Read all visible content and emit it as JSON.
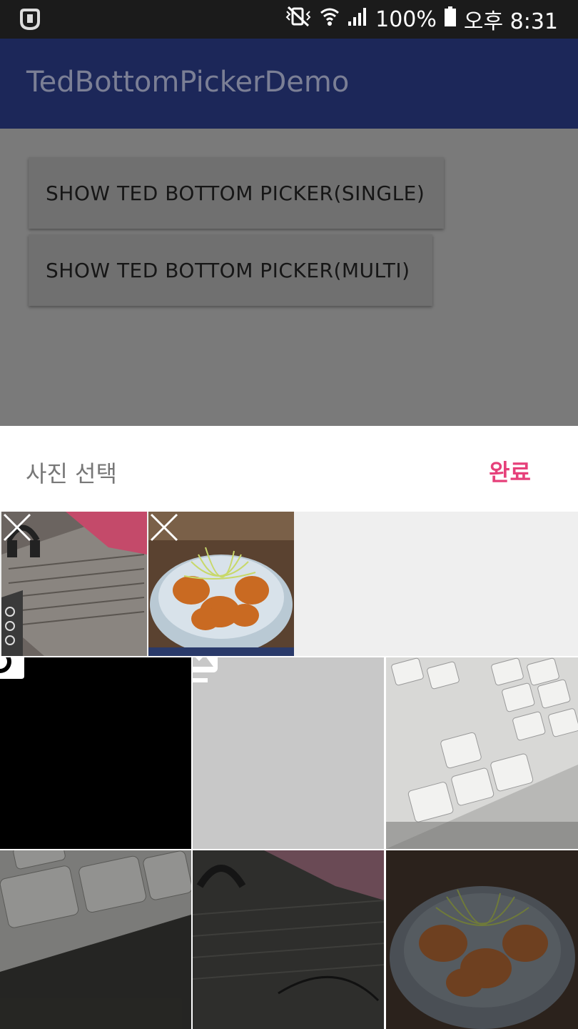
{
  "status_bar": {
    "battery": "100%",
    "time": "오후 8:31",
    "icons": [
      "app-notification-icon",
      "vibrate-mute-icon",
      "wifi-icon",
      "signal-icon",
      "battery-icon"
    ]
  },
  "app_bar": {
    "title": "TedBottomPickerDemo"
  },
  "main": {
    "buttons": [
      {
        "label": "SHOW TED BOTTOM PICKER(SINGLE)"
      },
      {
        "label": "SHOW TED BOTTOM PICKER(MULTI)"
      }
    ]
  },
  "bottom_sheet": {
    "title": "사진 선택",
    "done_label": "완료",
    "accent_color": "#e6407a",
    "selected": [
      {
        "name": "desk-photo",
        "remove_icon": "close-icon"
      },
      {
        "name": "food-photo",
        "remove_icon": "close-icon"
      }
    ],
    "grid": [
      {
        "type": "camera",
        "icon": "camera-icon"
      },
      {
        "type": "gallery",
        "icon": "photo-library-icon"
      },
      {
        "type": "photo",
        "name": "keyboard-photo"
      },
      {
        "type": "photo",
        "name": "keyboard-command-photo"
      },
      {
        "type": "photo",
        "name": "desk-photo"
      },
      {
        "type": "photo",
        "name": "food-photo"
      }
    ]
  }
}
